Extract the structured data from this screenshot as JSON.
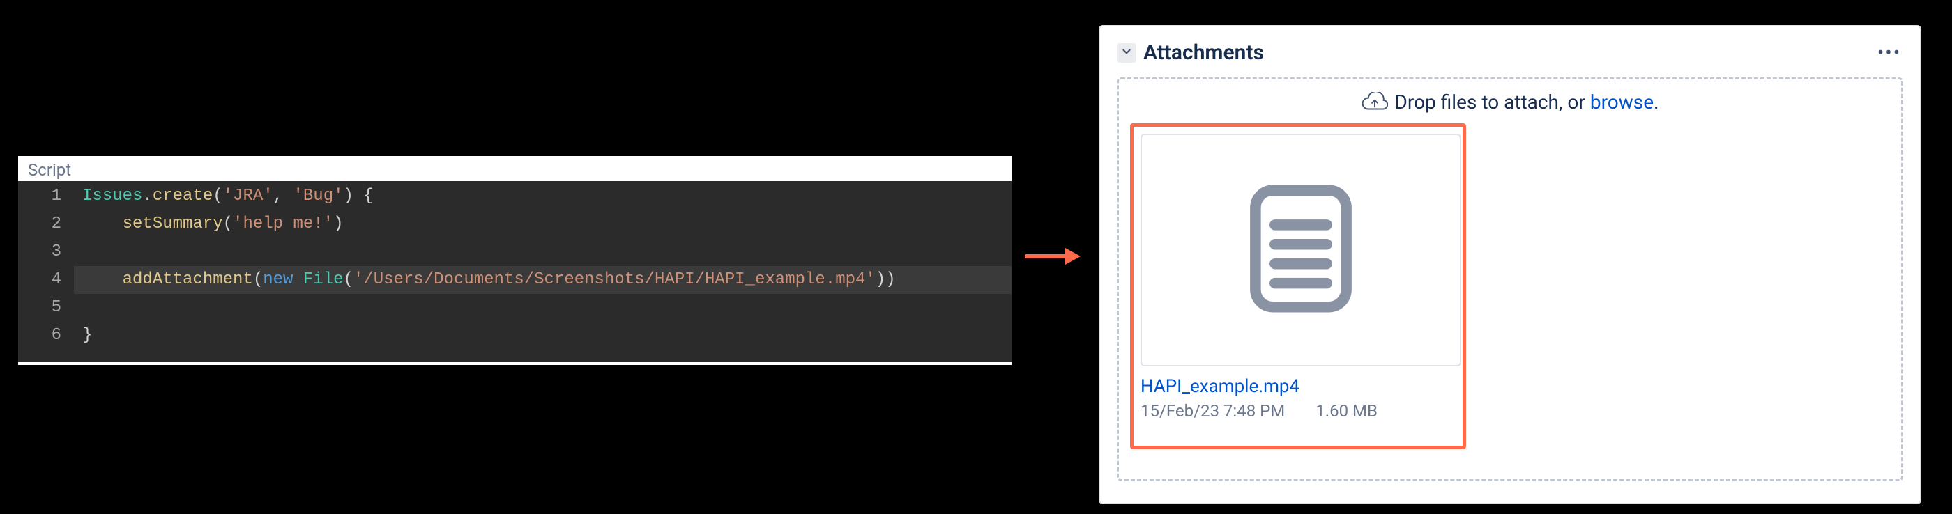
{
  "code_panel": {
    "title": "Script",
    "lines": [
      {
        "n": 1,
        "hl": false,
        "tokens": [
          {
            "c": "type",
            "t": "Issues"
          },
          {
            "c": "plain",
            "t": "."
          },
          {
            "c": "method",
            "t": "create"
          },
          {
            "c": "plain",
            "t": "("
          },
          {
            "c": "string",
            "t": "'JRA'"
          },
          {
            "c": "plain",
            "t": ", "
          },
          {
            "c": "string",
            "t": "'Bug'"
          },
          {
            "c": "plain",
            "t": ") {"
          }
        ]
      },
      {
        "n": 2,
        "hl": false,
        "tokens": [
          {
            "c": "plain",
            "t": "    "
          },
          {
            "c": "method",
            "t": "setSummary"
          },
          {
            "c": "plain",
            "t": "("
          },
          {
            "c": "string",
            "t": "'help me!'"
          },
          {
            "c": "plain",
            "t": ")"
          }
        ]
      },
      {
        "n": 3,
        "hl": false,
        "tokens": []
      },
      {
        "n": 4,
        "hl": true,
        "tokens": [
          {
            "c": "plain",
            "t": "    "
          },
          {
            "c": "method",
            "t": "addAttachment"
          },
          {
            "c": "plain",
            "t": "("
          },
          {
            "c": "kw",
            "t": "new"
          },
          {
            "c": "plain",
            "t": " "
          },
          {
            "c": "type",
            "t": "File"
          },
          {
            "c": "plain",
            "t": "("
          },
          {
            "c": "string",
            "t": "'/Users/Documents/Screenshots/HAPI/HAPI_example.mp4'"
          },
          {
            "c": "plain",
            "t": "))"
          }
        ]
      },
      {
        "n": 5,
        "hl": false,
        "tokens": []
      },
      {
        "n": 6,
        "hl": false,
        "tokens": [
          {
            "c": "plain",
            "t": "}"
          }
        ]
      }
    ]
  },
  "attachments_panel": {
    "header": {
      "title": "Attachments",
      "more_label": "•••"
    },
    "drop_hint_prefix": "Drop files to attach, or ",
    "drop_hint_link": "browse",
    "drop_hint_suffix": ".",
    "file": {
      "name": "HAPI_example.mp4",
      "date": "15/Feb/23 7:48 PM",
      "size": "1.60 MB"
    }
  }
}
